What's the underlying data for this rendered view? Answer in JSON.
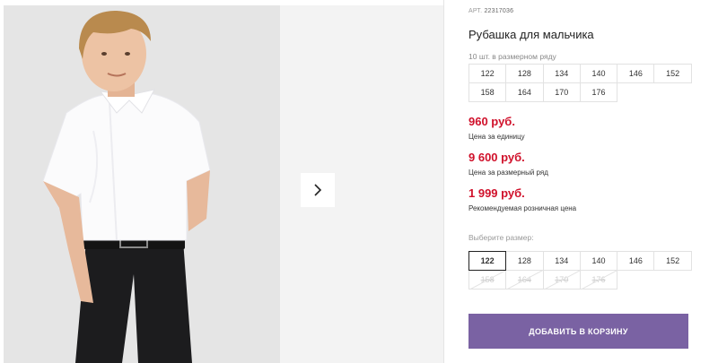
{
  "product": {
    "article_label": "АРТ.",
    "article_number": "22317036",
    "title": "Рубашка для мальчика"
  },
  "pack": {
    "label": "10 шт. в размерном ряду",
    "sizes": [
      "122",
      "128",
      "134",
      "140",
      "146",
      "152",
      "158",
      "164",
      "170",
      "176"
    ]
  },
  "prices": {
    "unit_price": "960 руб.",
    "unit_caption": "Цена за единицу",
    "pack_price": "9 600 руб.",
    "pack_caption": "Цена за размерный ряд",
    "retail_price": "1 999 руб.",
    "retail_caption": "Рекомендуемая розничная цена"
  },
  "size_select": {
    "label": "Выберите размер:",
    "selected": "122",
    "available": [
      "122",
      "128",
      "134",
      "140",
      "146",
      "152"
    ],
    "unavailable": [
      "158",
      "164",
      "170",
      "176"
    ]
  },
  "actions": {
    "add_to_cart": "ДОБАВИТЬ В КОРЗИНУ"
  },
  "icons": {
    "next": "chevron-right-icon"
  },
  "colors": {
    "price": "#d0112b",
    "cart_button": "#7a62a3"
  }
}
